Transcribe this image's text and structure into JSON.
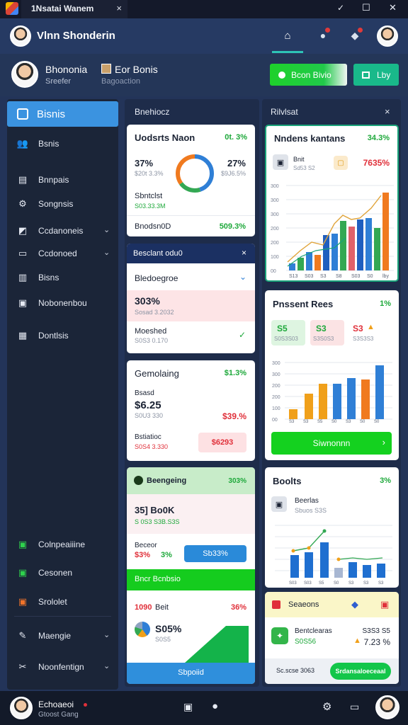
{
  "window": {
    "title": "1Nsatai Wanem",
    "tab_close": "×",
    "controls": [
      "✓",
      "☐",
      "✕"
    ]
  },
  "header": {
    "user_name": "Vlnn Shonderin",
    "accent": "#2ec4b6"
  },
  "profile": {
    "name": "Bhononia",
    "role": "Sreefer",
    "section_title": "Eor Bonis",
    "section_sub": "Bagoaction",
    "primary_btn": "Bcon Bivio",
    "secondary_btn": "Lby"
  },
  "sidebar": {
    "active": "Bisnis",
    "items": [
      "Bsnis",
      "Bnnpais",
      "Songnsis",
      "Ccdanoneis",
      "Ccdonoed",
      "Bisns",
      "Nobonenbou",
      "Dontlsis"
    ],
    "bottom_items": [
      "Colnpeaiiine",
      "Cesonen",
      "Srololet",
      "Maengie",
      "Noonfentign"
    ]
  },
  "panels": {
    "left_header": "Bnehiocz",
    "right_header": "Rilvlsat",
    "close": "×"
  },
  "card_donut": {
    "title": "Uodsrts Naon",
    "badge": "0t. 3%",
    "left_pct": "37%",
    "left_sub": "$20t 3.3%",
    "right_pct": "27%",
    "right_sub": "$9J6.5%",
    "label": "Sbntclst",
    "label_sub": "S03.33.3M",
    "footer_left": "Bnodsn0D",
    "footer_right": "509.3%",
    "donut": [
      {
        "label": "a",
        "value": 0.45,
        "color": "#2f7fd6"
      },
      {
        "label": "b",
        "value": 0.2,
        "color": "#33a853"
      },
      {
        "label": "c",
        "value": 0.35,
        "color": "#f07a1f"
      }
    ]
  },
  "card_bars1": {
    "title": "Nndens kantans",
    "badge": "34.3%",
    "item": "Bnit",
    "item_sub": "Sd53 S2",
    "metric": "7635%",
    "y_ticks": [
      "300",
      "300",
      "300",
      "200",
      "200",
      "100",
      "00"
    ],
    "x_ticks": [
      "S13",
      "S03",
      "S3",
      "S8",
      "S03",
      "S0",
      "lby"
    ]
  },
  "card_compare": {
    "header": "Besclant odu0",
    "title": "Bledoegroe",
    "v1": "303%",
    "v1_sub": "Sosad 3.2032",
    "label": "Moeshed",
    "label_sub": "S0S3 0.170"
  },
  "card_present": {
    "title": "Pnssent Rees",
    "badge": "1%",
    "tile1": "S5",
    "tile1_sub": "S0S3S03",
    "tile2": "S3",
    "tile2_sub": "S3S0S3",
    "tile3": "S3",
    "tile3_sub": "S3S3S3",
    "y_ticks": [
      "300",
      "300",
      "200",
      "200",
      "100",
      "00"
    ],
    "x_ticks": [
      "S3",
      "S3",
      "S5",
      "S0",
      "S3",
      "S0",
      "S0"
    ],
    "button": "Siwnonnn"
  },
  "card_gemolaing": {
    "title": "Gemolaing",
    "badge": "$1.3%",
    "label": "Bsasd",
    "value": "$6.25",
    "value_sub": "S0U3 330",
    "metric": "$39.%",
    "item": "Bstiatioc",
    "item_sub": "S0S4 3.330",
    "pill": "$6293"
  },
  "card_bank": {
    "title": "Beengeing",
    "badge": "303%",
    "value": "35] Bo0K",
    "value_sub": "S 0S3  S3B.S3S",
    "label": "Beceor",
    "v1": "$3%",
    "v2": "3%",
    "btn": "Sb33%",
    "banner": "Bncr Bcnbsio",
    "row_left": "1090",
    "row_label": "Beit",
    "row_right": "36%",
    "pie_val": "S05%",
    "pie_sub": "S0S5",
    "footer": "Sbpoiid"
  },
  "card_books": {
    "title": "Boolts",
    "badge": "3%",
    "item": "Beerlas",
    "item_sub": "Sbuos S3S",
    "x_ticks": [
      "S03",
      "S03",
      "S5",
      "S0",
      "S3",
      "S3",
      "S3"
    ]
  },
  "card_seasons": {
    "title": "Seaeons",
    "item": "Bentclearas",
    "item_sub": "S0S56",
    "m1": "S3S3 S5",
    "m2": "7.23 %",
    "footer_left": "Sc.scse 3063",
    "footer_btn": "Srdansaloeceaal"
  },
  "footer": {
    "user": "Echoaeoi",
    "sub": "Gtoost Gang"
  }
}
